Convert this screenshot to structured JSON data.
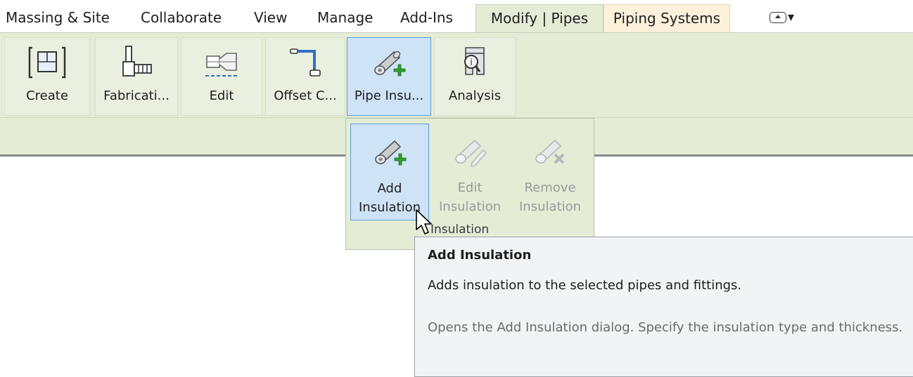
{
  "tabs": [
    {
      "label": "Massing & Site"
    },
    {
      "label": "Collaborate"
    },
    {
      "label": "View"
    },
    {
      "label": "Manage"
    },
    {
      "label": "Add-Ins"
    },
    {
      "label": "Modify | Pipes",
      "context": "green"
    },
    {
      "label": "Piping Systems",
      "context": "orange"
    }
  ],
  "ribbon": {
    "buttons": [
      {
        "label": "Create",
        "icon": "create-box-icon"
      },
      {
        "label": "Fabricati...",
        "icon": "fabrication-part-icon"
      },
      {
        "label": "Edit",
        "icon": "edit-pipe-icon"
      },
      {
        "label": "Offset C...",
        "icon": "offset-connections-icon"
      },
      {
        "label": "Pipe Insu...",
        "icon": "pipe-insulation-icon",
        "active": true
      },
      {
        "label": "Analysis",
        "icon": "analysis-icon"
      }
    ]
  },
  "dropdown": {
    "items": [
      {
        "line1": "Add",
        "line2": "Insulation",
        "icon": "add-insulation-icon",
        "enabled": true
      },
      {
        "line1": "Edit",
        "line2": "Insulation",
        "icon": "edit-insulation-icon",
        "enabled": false
      },
      {
        "line1": "Remove",
        "line2": "Insulation",
        "icon": "remove-insulation-icon",
        "enabled": false
      }
    ],
    "panel_label": "Insulation"
  },
  "tooltip": {
    "title": "Add Insulation",
    "description": "Adds insulation to the selected pipes and fittings.",
    "detail": "Opens the Add Insulation dialog. Specify the insulation type and thickness."
  },
  "colors": {
    "ribbon_bg": "#e4ecd6",
    "contextual_orange": "#fdf1dc",
    "highlight_bg": "#cfe3f6",
    "highlight_border": "#5a9bd5",
    "plus_green": "#2e9e2e"
  }
}
